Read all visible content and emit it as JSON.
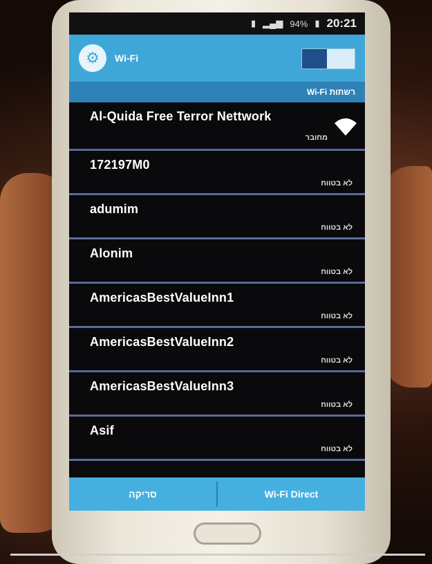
{
  "status_bar": {
    "time": "20:21",
    "battery": "94%"
  },
  "action_bar": {
    "title": "Wi-Fi",
    "toggle_state": "on"
  },
  "section_header": "Wi-Fi רשתות",
  "networks": [
    {
      "name": "Al-Quida Free Terror Nettwork",
      "status": "מחובר"
    },
    {
      "name": "172197M0",
      "status": "לא בטווח"
    },
    {
      "name": "adumim",
      "status": "לא בטווח"
    },
    {
      "name": "Alonim",
      "status": "לא בטווח"
    },
    {
      "name": "AmericasBestValueInn1",
      "status": "לא בטווח"
    },
    {
      "name": "AmericasBestValueInn2",
      "status": "לא בטווח"
    },
    {
      "name": "AmericasBestValueInn3",
      "status": "לא בטווח"
    },
    {
      "name": "Asif",
      "status": "לא בטווח"
    }
  ],
  "bottom_bar": {
    "left_button": "סריקה",
    "right_button": "Wi-Fi Direct"
  }
}
